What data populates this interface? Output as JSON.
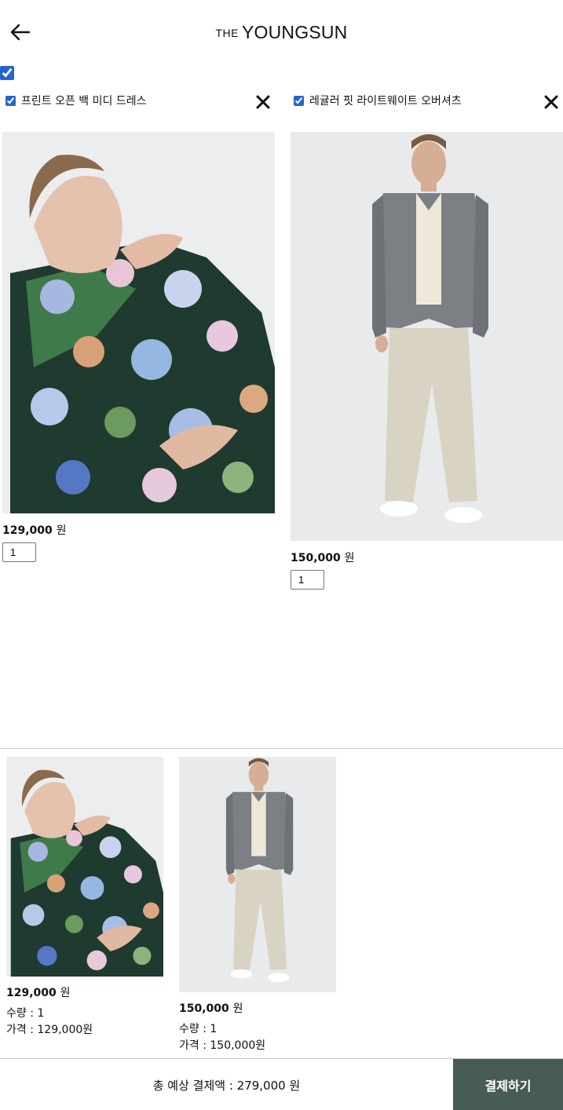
{
  "header": {
    "brand_small": "THE",
    "brand_big": "YOUNGSUN",
    "back_icon": "arrow-left-icon"
  },
  "select_all": {
    "checked": true
  },
  "cart": {
    "items": [
      {
        "name": "프린트 오픈 백 미디 드레스",
        "checked": true,
        "price": "129,000",
        "currency": "원",
        "quantity": "1",
        "image": "floral-dress-photo",
        "remove_icon": "close-icon"
      },
      {
        "name": "레귤러 핏 라이트웨이트 오버셔츠",
        "checked": true,
        "price": "150,000",
        "currency": "원",
        "quantity": "1",
        "image": "grey-overshirt-photo",
        "remove_icon": "close-icon"
      }
    ]
  },
  "summary": {
    "items": [
      {
        "price": "129,000",
        "currency": "원",
        "quantity_line": "수량 : 1",
        "total_line": "가격 : 129,000원"
      },
      {
        "price": "150,000",
        "currency": "원",
        "quantity_line": "수량 : 1",
        "total_line": "가격 : 150,000원"
      }
    ]
  },
  "footer": {
    "total_text": "총 예상 결제액 : 279,000 원",
    "checkout_label": "결제하기"
  },
  "colors": {
    "checkout_bg": "#475c53",
    "checkbox_accent": "#2463d6"
  }
}
